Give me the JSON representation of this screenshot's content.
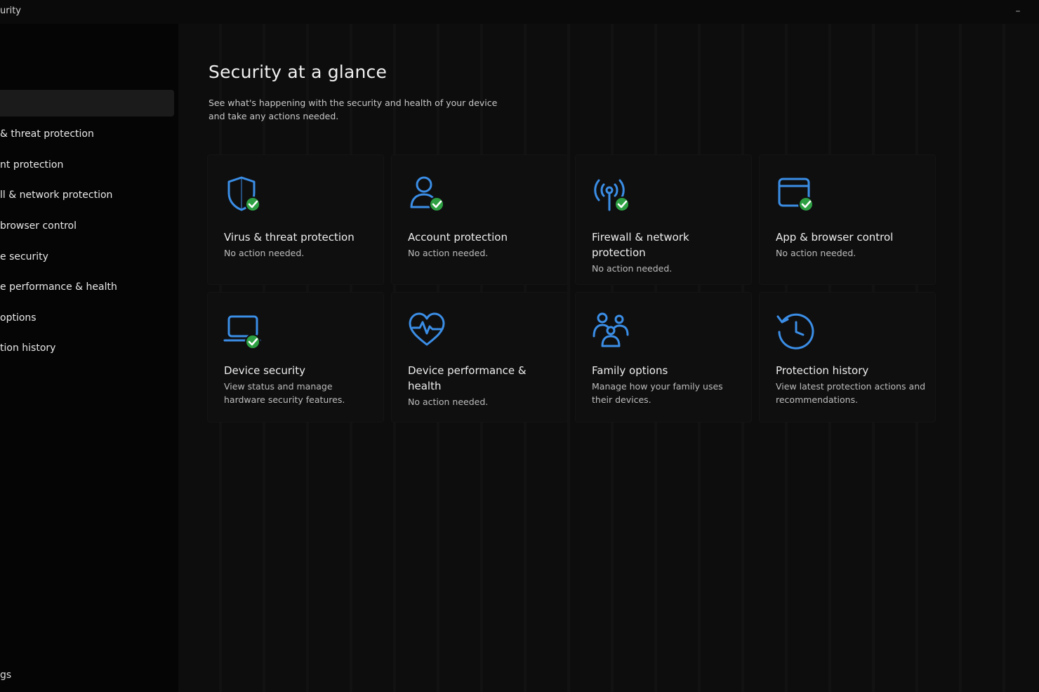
{
  "window": {
    "title": "urity",
    "minimize_glyph": "–"
  },
  "sidebar": {
    "items": [
      {
        "label": "& threat protection"
      },
      {
        "label": "nt protection"
      },
      {
        "label": "ll & network protection"
      },
      {
        "label": " browser control"
      },
      {
        "label": "e security"
      },
      {
        "label": "e performance & health"
      },
      {
        "label": " options"
      },
      {
        "label": "tion history"
      }
    ],
    "settings_label": "gs"
  },
  "main": {
    "title": "Security at a glance",
    "subtitle": "See what's happening with the security and health of your device and take any actions needed."
  },
  "cards": [
    {
      "title": "Virus & threat protection",
      "status": "No action needed.",
      "icon": "shield-icon"
    },
    {
      "title": "Account protection",
      "status": "No action needed.",
      "icon": "account-icon"
    },
    {
      "title": "Firewall & network protection",
      "status": "No action needed.",
      "icon": "antenna-icon"
    },
    {
      "title": "App & browser control",
      "status": "No action needed.",
      "icon": "browser-window-icon"
    },
    {
      "title": "Device security",
      "status": "View status and manage hardware security features.",
      "icon": "laptop-icon"
    },
    {
      "title": "Device performance & health",
      "status": "No action needed.",
      "icon": "heart-pulse-icon"
    },
    {
      "title": "Family options",
      "status": "Manage how your family uses their devices.",
      "icon": "family-icon"
    },
    {
      "title": "Protection history",
      "status": "View latest protection actions and recommendations.",
      "icon": "history-clock-icon"
    }
  ],
  "colors": {
    "accent_blue": "#3b8ee6",
    "check_green": "#2ea043",
    "background": "#0d0d0e",
    "sidebar_background": "#050505"
  }
}
